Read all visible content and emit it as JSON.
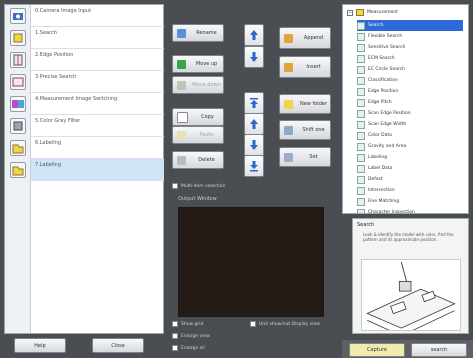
{
  "flow": {
    "rows": [
      {
        "label": "0.Camera Image Input"
      },
      {
        "label": "1.Search"
      },
      {
        "label": "2.Edge Position"
      },
      {
        "label": "3.Precise Search"
      },
      {
        "label": "4.Measurement Image Switching"
      },
      {
        "label": "5.Color Gray Filter"
      },
      {
        "label": "6.Labeling"
      },
      {
        "label": "7.Labeling"
      }
    ],
    "selected_index": 7
  },
  "buttons": {
    "rename": "Rename",
    "move_up": "Move up",
    "move_down": "Move down",
    "append": "Append",
    "insert": "Insert",
    "copy": "Copy",
    "paste": "Paste",
    "delete": "Delete",
    "new_folder": "New folder",
    "shift_one": "Shift one",
    "set": "Set",
    "help": "Help",
    "close": "Close",
    "capture": "Capture",
    "search": "search"
  },
  "options": {
    "edit_window_selection": "Multi-item selection",
    "output_window_label": "Output Window",
    "show_grid": "Show grid",
    "enlarge_view": "Enlarge view",
    "enlarge_all": "Enlarge all",
    "unit_show": "Unit show/not Display view"
  },
  "tree": {
    "root": "Measurement",
    "items": [
      "Search",
      "Flexible Search",
      "Sensitive Search",
      "ECM Search",
      "EC Circle Search",
      "Classification",
      "Edge Position",
      "Edge Pitch",
      "Scan Edge Position",
      "Scan Edge Width",
      "Color Data",
      "Gravity and Area",
      "Labeling",
      "Label Data",
      "Defect",
      "Intersection",
      "Fine Matching",
      "Character Inspection"
    ],
    "selected_index": 0
  },
  "description": {
    "title": "Search",
    "text": "Look & identify the model with color, find the pattern and its approximate position."
  },
  "icons": {
    "flow": [
      "camera-icon",
      "search-icon",
      "edge-icon",
      "precise-search-icon",
      "switch-icon",
      "filter-icon",
      "label-icon",
      "label-icon"
    ]
  },
  "colors": {
    "background": "#4a4d52",
    "selection": "#2d6ad8",
    "capture_btn": "#f0ecb0",
    "output_bg": "#241a16"
  }
}
